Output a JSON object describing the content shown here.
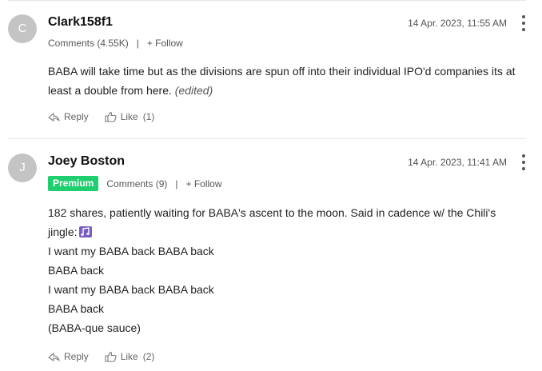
{
  "comments": [
    {
      "avatar_initial": "C",
      "username": "Clark158f1",
      "timestamp": "14 Apr. 2023, 11:55 AM",
      "comments_count": "Comments (4.55K)",
      "separator": "|",
      "follow_label": "+ Follow",
      "body_text": "BABA will take time but as the divisions are spun off into their individual IPO'd companies its at least a double from here.",
      "edited_label": "(edited)",
      "reply_label": "Reply",
      "like_label": "Like",
      "like_count": "(1)"
    },
    {
      "avatar_initial": "J",
      "username": "Joey Boston",
      "badge": "Premium",
      "timestamp": "14 Apr. 2023, 11:41 AM",
      "comments_count": "Comments (9)",
      "separator": "|",
      "follow_label": "+ Follow",
      "body_lines": [
        "182 shares, patiently waiting for BABA's ascent to the moon. Said in cadence w/ the Chili's",
        "jingle:",
        "I want my BABA back BABA back",
        "BABA back",
        "I want my BABA back BABA back",
        "BABA back",
        "(BABA-que sauce)"
      ],
      "reply_label": "Reply",
      "like_label": "Like",
      "like_count": "(2)"
    }
  ],
  "icons": {
    "reply": "reply-arrow-icon",
    "like": "thumbs-up-icon",
    "more": "more-vertical-icon",
    "music": "musical-notes-icon"
  },
  "colors": {
    "premium_badge": "#1fce6e",
    "avatar": "#c4c4c4"
  }
}
